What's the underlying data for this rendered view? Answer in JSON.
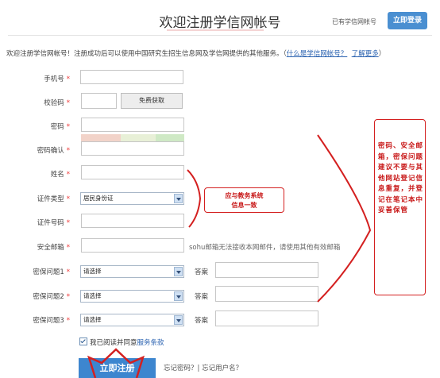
{
  "header": {
    "title": "欢迎注册学信网帐号",
    "has_account": "已有学信网帐号",
    "login_button": "立即登录"
  },
  "intro": {
    "text": "欢迎注册学信网帐号！注册成功后可以使用中国研究生招生信息网及学信网提供的其他服务。（",
    "link_what": "什么是学信网帐号？",
    "link_more": "了解更多",
    "close": "）"
  },
  "form": {
    "required_mark": "*",
    "phone_label": "手机号",
    "code_label": "校验码",
    "get_code_button": "免费获取",
    "password_label": "密码",
    "password_confirm_label": "密码确认",
    "name_label": "姓名",
    "id_type_label": "证件类型",
    "id_type_value": "居民身份证",
    "id_number_label": "证件号码",
    "email_label": "安全邮箱",
    "email_hint": "sohu邮箱无法接收本网邮件，请使用其他有效邮箱",
    "q1_label": "密保问题1",
    "q2_label": "密保问题2",
    "q3_label": "密保问题3",
    "select_placeholder": "请选择",
    "answer_label": "答案",
    "agree_text": "我已阅读并同意",
    "terms_link": "服务条款",
    "register_button": "立即注册",
    "forgot_text": "忘记密码？| 忘记用户名？"
  },
  "annotations": {
    "note_left_line1": "应与教务系统",
    "note_left_line2": "信息一致",
    "note_right": "密码、安全邮箱，密保问题建议不要与其他网站登记信息重复，并登记在笔记本中妥善保管",
    "color": "#d42020"
  },
  "colors": {
    "accent_blue": "#4a8fd1",
    "register_blue": "#3d86cf",
    "required_red": "#e33333",
    "strength_weak": "#f2d3c9",
    "strength_mid": "#e8f0d7",
    "strength_strong": "#cfe9c5"
  }
}
